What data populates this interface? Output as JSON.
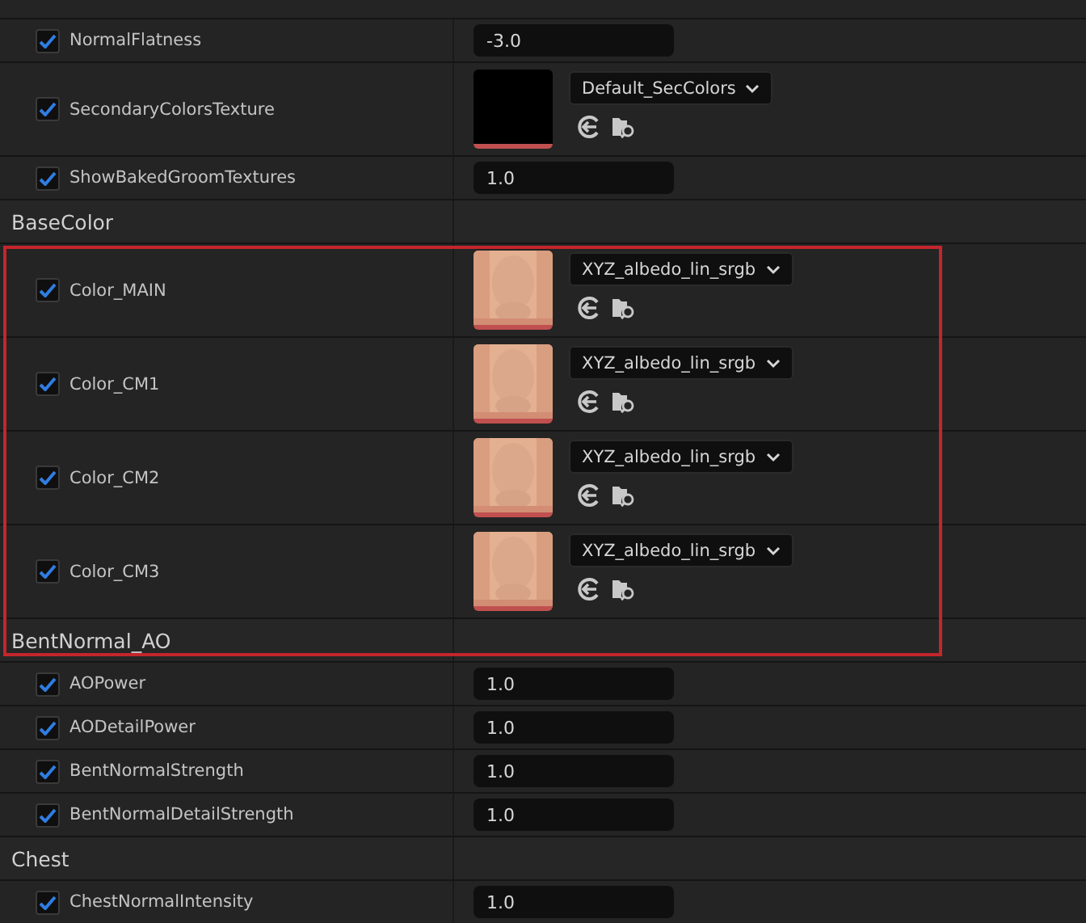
{
  "groups": [
    {
      "rows": [
        {
          "kind": "scalar",
          "name": "NormalFlatness",
          "checked": true,
          "value": "-3.0"
        },
        {
          "kind": "texture",
          "name": "SecondaryColorsTexture",
          "checked": true,
          "asset": "Default_SecColors",
          "thumbnail": {
            "kind": "blank"
          }
        },
        {
          "kind": "scalar",
          "name": "ShowBakedGroomTextures",
          "checked": true,
          "value": "1.0"
        }
      ]
    },
    {
      "title": "BaseColor",
      "highlighted": true,
      "rows": [
        {
          "kind": "texture",
          "name": "Color_MAIN",
          "checked": true,
          "asset": "XYZ_albedo_lin_srgb"
        },
        {
          "kind": "texture",
          "name": "Color_CM1",
          "checked": true,
          "asset": "XYZ_albedo_lin_srgb"
        },
        {
          "kind": "texture",
          "name": "Color_CM2",
          "checked": true,
          "asset": "XYZ_albedo_lin_srgb"
        },
        {
          "kind": "texture",
          "name": "Color_CM3",
          "checked": true,
          "asset": "XYZ_albedo_lin_srgb"
        }
      ]
    },
    {
      "title": "BentNormal_AO",
      "rows": [
        {
          "kind": "scalar",
          "name": "AOPower",
          "checked": true,
          "value": "1.0"
        },
        {
          "kind": "scalar",
          "name": "AODetailPower",
          "checked": true,
          "value": "1.0"
        },
        {
          "kind": "scalar",
          "name": "BentNormalStrength",
          "checked": true,
          "value": "1.0"
        },
        {
          "kind": "scalar",
          "name": "BentNormalDetailStrength",
          "checked": true,
          "value": "1.0"
        }
      ]
    },
    {
      "title": "Chest",
      "rows": [
        {
          "kind": "scalar",
          "name": "ChestNormalIntensity",
          "checked": true,
          "value": "1.0"
        }
      ]
    }
  ]
}
